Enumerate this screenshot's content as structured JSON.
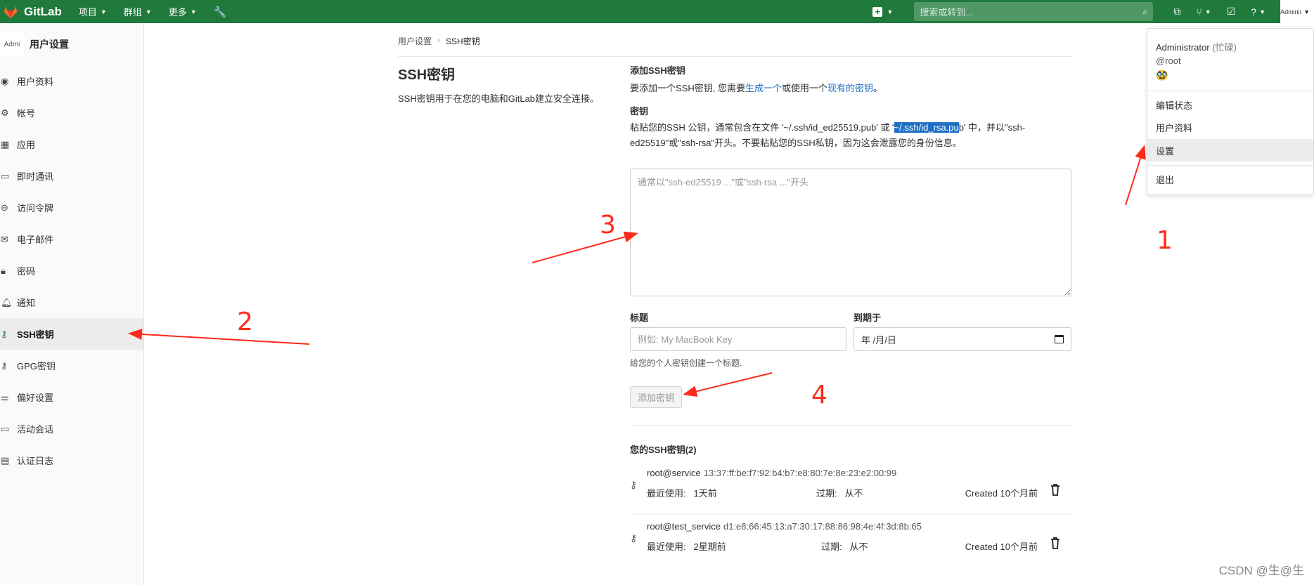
{
  "topbar": {
    "app_name": "GitLab",
    "menus": [
      "项目",
      "群组",
      "更多"
    ],
    "search_placeholder": "搜索或转到...",
    "avatar_alt": "Administrator"
  },
  "sidebar": {
    "avatar_alt": "Admi",
    "title": "用户设置",
    "items": [
      {
        "label": "用户资料",
        "icon": "user-icon"
      },
      {
        "label": "帐号",
        "icon": "account-icon"
      },
      {
        "label": "应用",
        "icon": "apps-icon"
      },
      {
        "label": "即时通讯",
        "icon": "chat-icon"
      },
      {
        "label": "访问令牌",
        "icon": "token-icon"
      },
      {
        "label": "电子邮件",
        "icon": "mail-icon"
      },
      {
        "label": "密码",
        "icon": "lock-icon"
      },
      {
        "label": "通知",
        "icon": "bell-icon"
      },
      {
        "label": "SSH密钥",
        "icon": "key-icon",
        "active": true
      },
      {
        "label": "GPG密钥",
        "icon": "key-icon"
      },
      {
        "label": "偏好设置",
        "icon": "preferences-icon"
      },
      {
        "label": "活动会话",
        "icon": "monitor-icon"
      },
      {
        "label": "认证日志",
        "icon": "log-icon"
      }
    ]
  },
  "breadcrumb": {
    "parent": "用户设置",
    "current": "SSH密钥"
  },
  "page": {
    "title": "SSH密钥",
    "description": "SSH密钥用于在您的电脑和GitLab建立安全连接。"
  },
  "form": {
    "section_title": "添加SSH密钥",
    "intro_before": "要添加一个SSH密钥, 您需要",
    "intro_link1": "生成一个",
    "intro_mid": "或使用一个",
    "intro_link2": "现有的密钥",
    "intro_end": "。",
    "key_label": "密钥",
    "key_help_1": "粘贴您的SSH 公钥，通常包含在文件 '~/.ssh/id_ed25519.pub' 或 '",
    "key_help_hl": "~/.ssh/id_rsa.pu",
    "key_help_2": "b' 中，并以\"ssh-",
    "key_help_3": "ed25519\"或\"ssh-rsa\"开头。不要粘贴您的SSH私钥，因为这会泄露您的身份信息。",
    "key_placeholder": "通常以\"ssh-ed25519 ...\"或\"ssh-rsa ...\"开头",
    "title_label": "标题",
    "title_placeholder": "例如: My MacBook Key",
    "expires_label": "到期于",
    "date_placeholder": "年 /月/日",
    "title_help": "给您的个人密钥创建一个标题.",
    "submit_label": "添加密钥"
  },
  "keys": {
    "title": "您的SSH密钥(2)",
    "items": [
      {
        "name": "root@service",
        "fingerprint": "13:37:ff:be:f7:92:b4:b7:e8:80:7e:8e:23:e2:00:99",
        "last_used_label": "最近使用:",
        "last_used": "1天前",
        "expires_label": "过期:",
        "expires": "从不",
        "created": "Created 10个月前"
      },
      {
        "name": "root@test_service",
        "fingerprint": "d1:e8:66:45:13:a7:30:17:88:86:98:4e:4f:3d:8b:65",
        "last_used_label": "最近使用:",
        "last_used": "2星期前",
        "expires_label": "过期:",
        "expires": "从不",
        "created": "Created 10个月前"
      }
    ]
  },
  "dropdown": {
    "name": "Administrator",
    "status": "(忙碌)",
    "handle": "@root",
    "status_emoji": "🥸",
    "items": [
      "编辑状态",
      "用户资料",
      "设置",
      "退出"
    ]
  },
  "annotations": {
    "n1": "1",
    "n2": "2",
    "n3": "3",
    "n4": "4",
    "color": "#ff2a1a"
  },
  "watermark": "CSDN @生@生"
}
